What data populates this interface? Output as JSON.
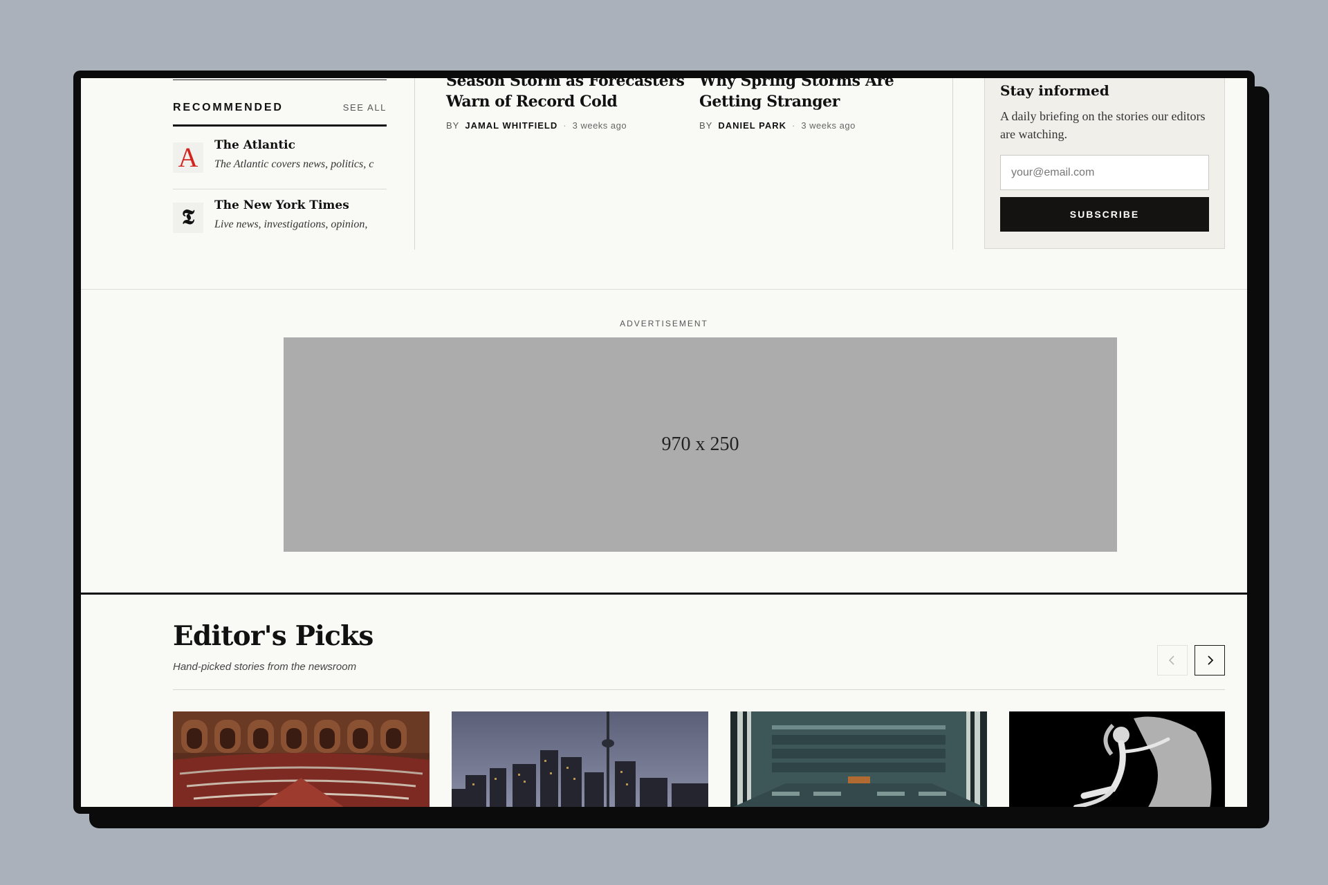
{
  "recommended": {
    "title": "RECOMMENDED",
    "see_all": "SEE ALL",
    "items": [
      {
        "logo": "A",
        "name": "The Atlantic",
        "desc": "The Atlantic covers news, politics, c"
      },
      {
        "logo": "𝕿",
        "name": "The New York Times",
        "desc": "Live news, investigations, opinion,"
      }
    ]
  },
  "articles": [
    {
      "title": "Season Storm as Forecasters Warn of Record Cold",
      "by": "BY",
      "author": "JAMAL WHITFIELD",
      "time": "3 weeks ago"
    },
    {
      "title": "Why Spring Storms Are Getting Stranger",
      "by": "BY",
      "author": "DANIEL PARK",
      "time": "3 weeks ago"
    }
  ],
  "newsletter": {
    "title": "Stay informed",
    "description": "A daily briefing on the stories our editors are watching.",
    "email_placeholder": "your@email.com",
    "button": "SUBSCRIBE"
  },
  "ad": {
    "label": "ADVERTISEMENT",
    "size": "970 x 250"
  },
  "editors_picks": {
    "title": "Editor's Picks",
    "subtitle": "Hand-picked stories from the newsroom",
    "cards": [
      {
        "image": "parliament-chamber"
      },
      {
        "image": "city-skyline-night"
      },
      {
        "image": "assembly-hall"
      },
      {
        "image": "dancer-black-white"
      }
    ]
  },
  "colors": {
    "page_bg": "#f9f9f5",
    "outer_bg": "#aab1ba",
    "ink": "#111111",
    "atlantic_red": "#d2231f",
    "ad_gray": "#acacac"
  }
}
